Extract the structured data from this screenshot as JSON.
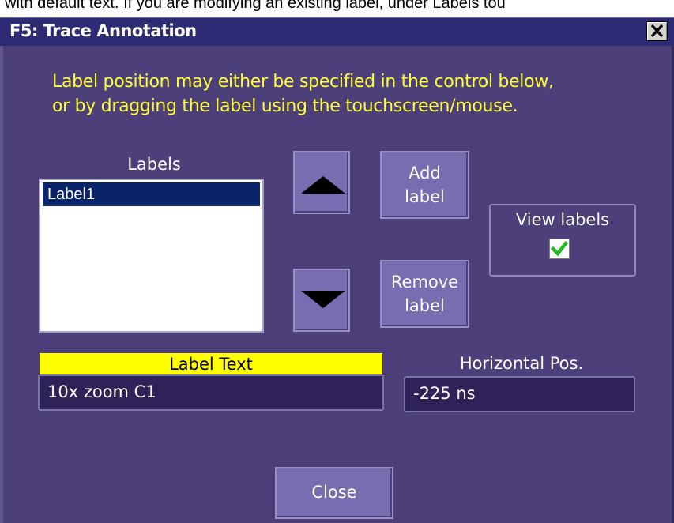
{
  "background_text": "with default text. If you are modifying an existing label, under Labels tou",
  "dialog": {
    "title": "F5: Trace Annotation",
    "close_glyph": "✕",
    "message_line1": "Label position may either be specified in the control below,",
    "message_line2": "or by dragging the label using the touchscreen/mouse.",
    "labels_heading": "Labels",
    "labels": [
      "Label1"
    ],
    "add_label": [
      "Add",
      "label"
    ],
    "remove_label": [
      "Remove",
      "label"
    ],
    "view_labels": "View labels",
    "view_labels_checked": true,
    "label_text_heading": "Label Text",
    "label_text_value": "10x zoom C1",
    "horizontal_pos_heading": "Horizontal Pos.",
    "horizontal_pos_value": "-225 ns",
    "close_button": "Close"
  },
  "colors": {
    "dialog_bg": "#4d3f7a",
    "title_bar": "#2c2b73",
    "message_text": "#ffff33",
    "button_bg": "#786db0",
    "selection": "#0a246a",
    "checkmark": "#22bb22"
  },
  "icons": [
    "up-arrow-icon",
    "down-arrow-icon",
    "checkmark-icon",
    "close-icon"
  ]
}
